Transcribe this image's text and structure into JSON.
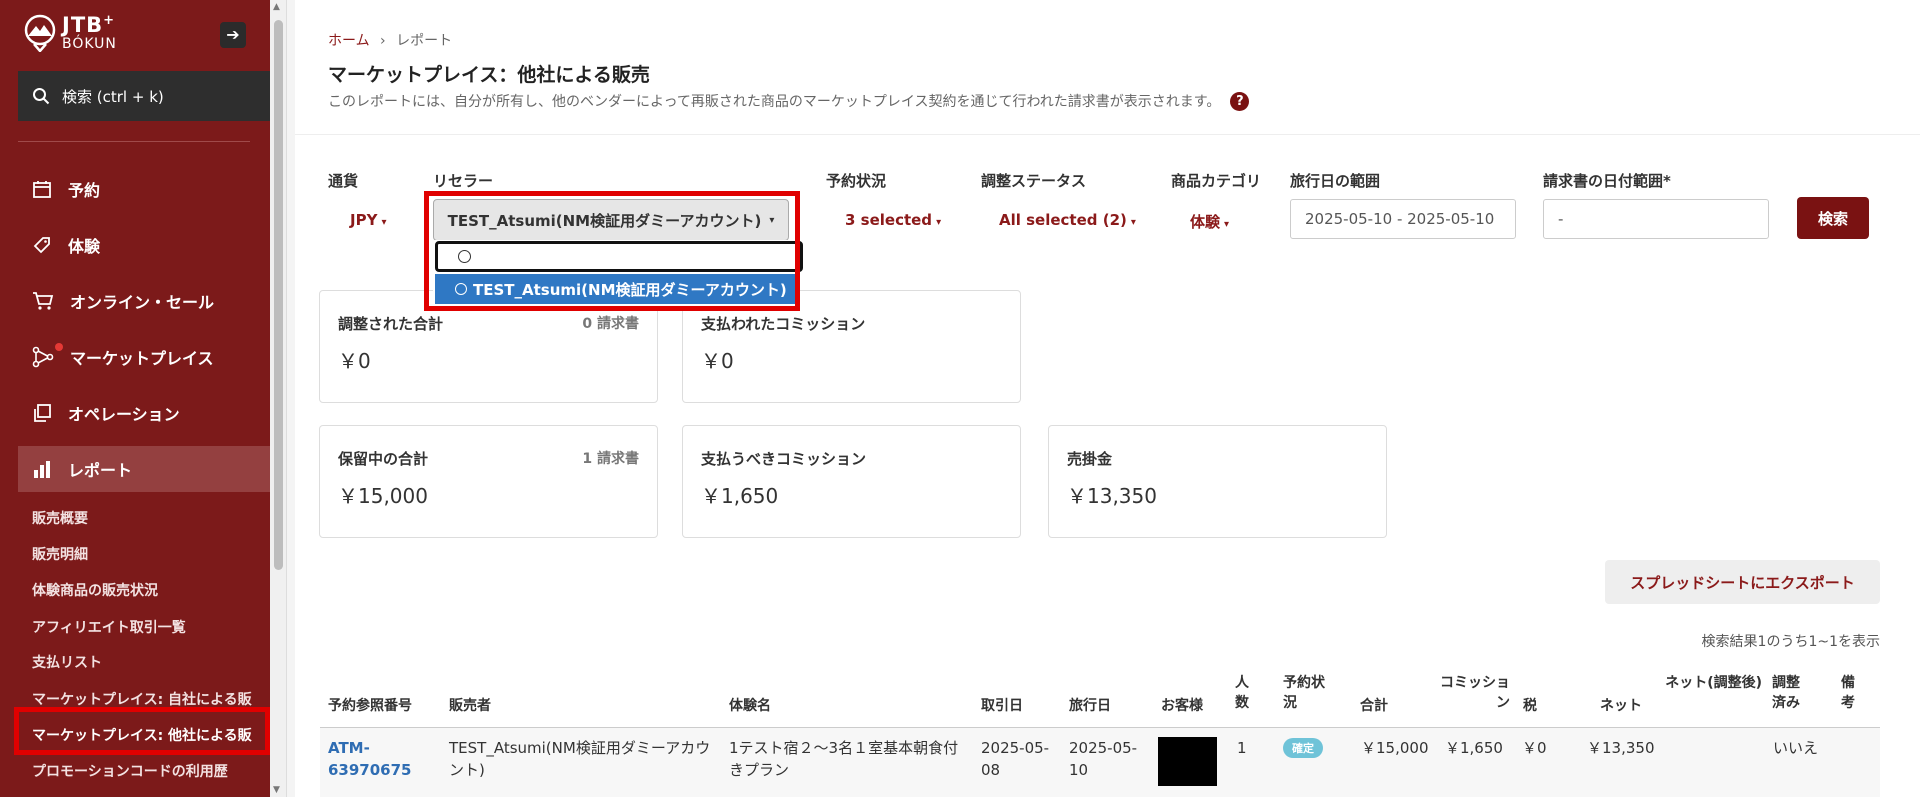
{
  "sidebar": {
    "logo_line1": "JTB",
    "logo_plus": "+",
    "logo_line2": "BÓKUN",
    "search_label": "検索 (ctrl + k)",
    "nav": [
      {
        "label": "予約",
        "icon": "calendar-icon"
      },
      {
        "label": "体験",
        "icon": "tag-icon"
      },
      {
        "label": "オンライン・セール",
        "icon": "cart-icon"
      },
      {
        "label": "マーケットプレイス",
        "icon": "network-icon"
      },
      {
        "label": "オペレーション",
        "icon": "copy-icon"
      },
      {
        "label": "レポート",
        "icon": "bar-chart-icon"
      }
    ],
    "sub": [
      "販売概要",
      "販売明細",
      "体験商品の販売状況",
      "アフィリエイト取引一覧",
      "支払リスト",
      "マーケットプレイス: 自社による販",
      "マーケットプレイス: 他社による販",
      "プロモーションコードの利用歴"
    ]
  },
  "header": {
    "breadcrumb_home": "ホーム",
    "breadcrumb_sep": "›",
    "breadcrumb_current": "レポート",
    "title": "マーケットプレイス：他社による販売",
    "description": "このレポートには、自分が所有し、他のベンダーによって再販された商品のマーケットプレイス契約を通じて行われた請求書が表示されます。",
    "help": "?"
  },
  "filters": {
    "currency_label": "通貨",
    "currency_value": "JPY",
    "reseller_label": "リセラー",
    "reseller_value": "TEST_Atsumi(NM検証用ダミーアカウント)",
    "booking_status_label": "予約状況",
    "booking_status_value": "3 selected",
    "adjustment_status_label": "調整ステータス",
    "adjustment_status_value": "All selected (2)",
    "category_label": "商品カテゴリ",
    "category_value": "体験",
    "travel_date_label": "旅行日の範囲",
    "travel_date_value": "2025-05-10 - 2025-05-10",
    "invoice_date_label": "請求書の日付範囲*",
    "invoice_date_value": "-",
    "search_button": "検索"
  },
  "dropdown": {
    "options": [
      "TEST_Atsumi(NM検証用ダミーアカウント)"
    ]
  },
  "cards": [
    {
      "label": "調整された合計",
      "count": "0 請求書",
      "value": "￥0"
    },
    {
      "label": "支払われたコミッション",
      "count": "",
      "value": "￥0"
    },
    {
      "label": "保留中の合計",
      "count": "1 請求書",
      "value": "￥15,000"
    },
    {
      "label": "支払うべきコミッション",
      "count": "",
      "value": "￥1,650"
    },
    {
      "label": "売掛金",
      "count": "",
      "value": "￥13,350"
    }
  ],
  "export_button": "スプレッドシートにエクスポート",
  "result_info": "検索結果1のうち1~1を表示",
  "table": {
    "headers": [
      "予約参照番号",
      "販売者",
      "体験名",
      "取引日",
      "旅行日",
      "お客様",
      "人数",
      "予約状況",
      "合計",
      "コミッション",
      "税",
      "ネット",
      "ネット(調整後)",
      "調整済み",
      "備考"
    ],
    "row": {
      "ref": "ATM-63970675",
      "seller": "TEST_Atsumi(NM検証用ダミーアカウント)",
      "experience": "1テスト宿２〜3名１室基本朝食付きプラン",
      "transaction_date": "2025-05-08",
      "travel_date": "2025-05-10",
      "people": "1",
      "status": "確定",
      "total": "￥15,000",
      "commission": "￥1,650",
      "tax": "￥0",
      "net": "￥13,350",
      "net_adjusted": "",
      "adjusted": "いいえ",
      "notes": ""
    }
  }
}
